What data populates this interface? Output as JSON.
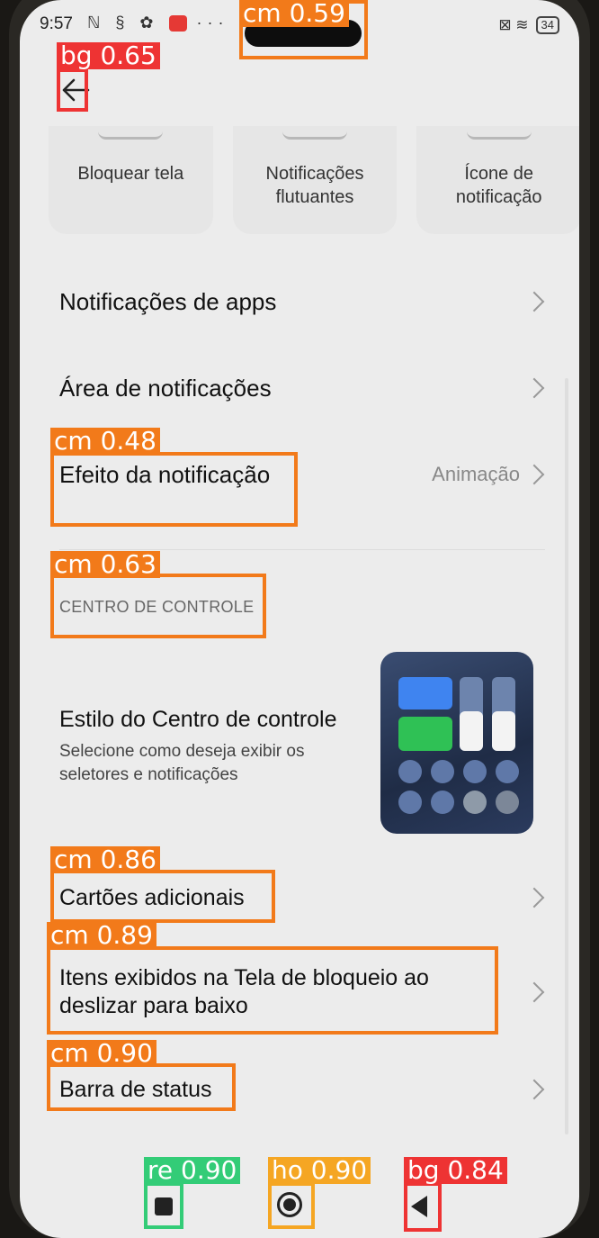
{
  "status_bar": {
    "time": "9:57",
    "icons_left": "ℕ § ✿",
    "more": "···",
    "icons_right": "⊠ ≋",
    "battery": "34"
  },
  "quick_cards": [
    {
      "label": "Bloquear tela"
    },
    {
      "label": "Notificações flutuantes"
    },
    {
      "label": "Ícone de notificação"
    }
  ],
  "settings": {
    "app_notifications": "Notificações de apps",
    "notification_area": "Área de notificações",
    "notification_effect": {
      "label": "Efeito da notificação",
      "value": "Animação"
    },
    "control_center_header": "CENTRO DE CONTROLE",
    "control_center_style": {
      "title": "Estilo do Centro de controle",
      "subtitle": "Selecione como deseja exibir os seletores e notificações"
    },
    "additional_cards": "Cartões adicionais",
    "lockscreen_items": "Itens exibidos na Tela de bloqueio ao deslizar para baixo",
    "status_bar": "Barra de status"
  },
  "detections": [
    {
      "label": "bg 0.65",
      "color": "#ee3333"
    },
    {
      "label": "cm 0.59",
      "color": "#f27a1a"
    },
    {
      "label": "cm 0.48",
      "color": "#f27a1a"
    },
    {
      "label": "cm 0.63",
      "color": "#f27a1a"
    },
    {
      "label": "cm 0.86",
      "color": "#f27a1a"
    },
    {
      "label": "cm 0.89",
      "color": "#f27a1a"
    },
    {
      "label": "cm 0.90",
      "color": "#f27a1a"
    },
    {
      "label": "re 0.90",
      "color": "#33cc77"
    },
    {
      "label": "ho 0.90",
      "color": "#f5a623"
    },
    {
      "label": "bg 0.84",
      "color": "#ee3333"
    }
  ]
}
